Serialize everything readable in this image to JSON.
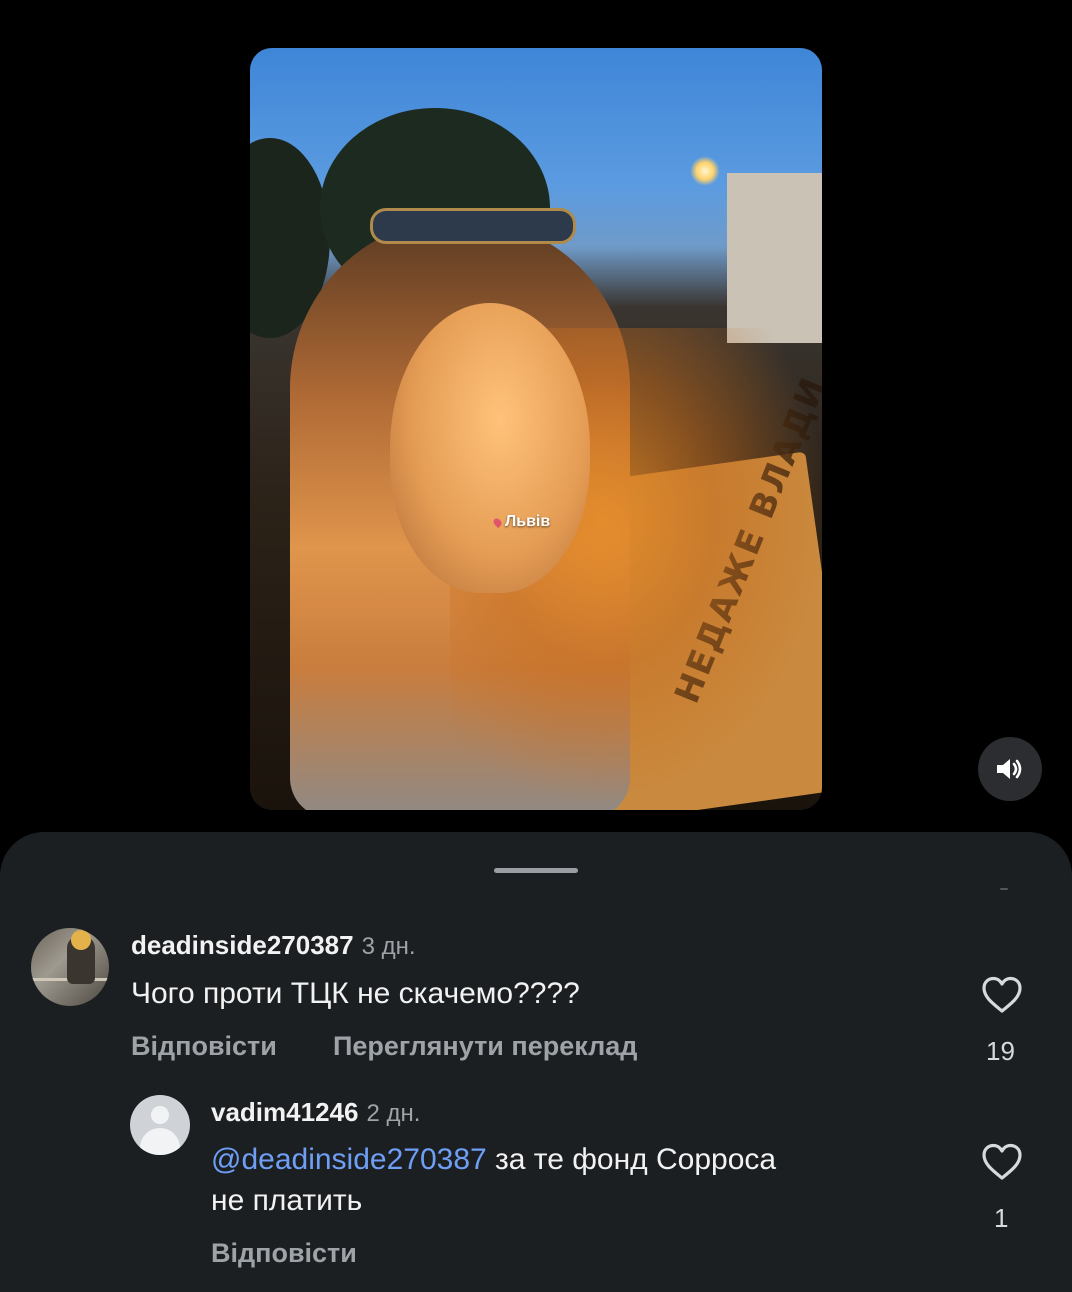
{
  "video": {
    "location_label": "Львів"
  },
  "comments": [
    {
      "username": "deadinside270387",
      "time": "3 дн.",
      "text": "Чого проти ТЦК не скачемо????",
      "reply_label": "Відповісти",
      "translate_label": "Переглянути переклад",
      "likes": "19"
    },
    {
      "username": "vadim41246",
      "time": "2 дн.",
      "mention": "@deadinside270387",
      "text_line1": "за те фонд Сорроса",
      "text_line2": "не платить",
      "reply_label": "Відповісти",
      "likes": "1"
    }
  ],
  "icons": {
    "sound": "speaker-volume-icon",
    "like": "heart-outline-icon"
  }
}
